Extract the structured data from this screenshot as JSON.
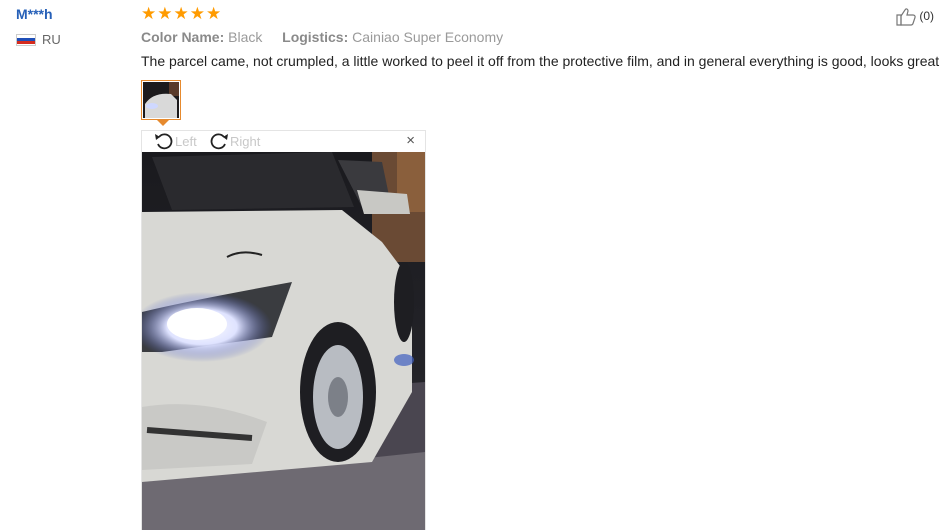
{
  "reviewer": {
    "name": "M***h",
    "country": "RU",
    "flag_colors": [
      "#ffffff",
      "#1f4fb8",
      "#d52b1e"
    ]
  },
  "rating": {
    "stars": 5,
    "max": 5,
    "color": "#ff9b00"
  },
  "attributes": {
    "color_key": "Color Name:",
    "color_value": "Black",
    "logistics_key": "Logistics:",
    "logistics_value": "Cainiao Super Economy"
  },
  "review_text": "The parcel came, not crumpled, a little worked to peel it off from the protective film, and in general everything is good, looks great",
  "helpful": {
    "count_text": "(0)",
    "icon": "thumbs-up-icon"
  },
  "image_viewer": {
    "rotate_left_label": "Left",
    "rotate_right_label": "Right",
    "close_label": "×",
    "icons": [
      "rotate-left-icon",
      "rotate-right-icon",
      "close-icon"
    ],
    "accent": "#e68a2e"
  }
}
